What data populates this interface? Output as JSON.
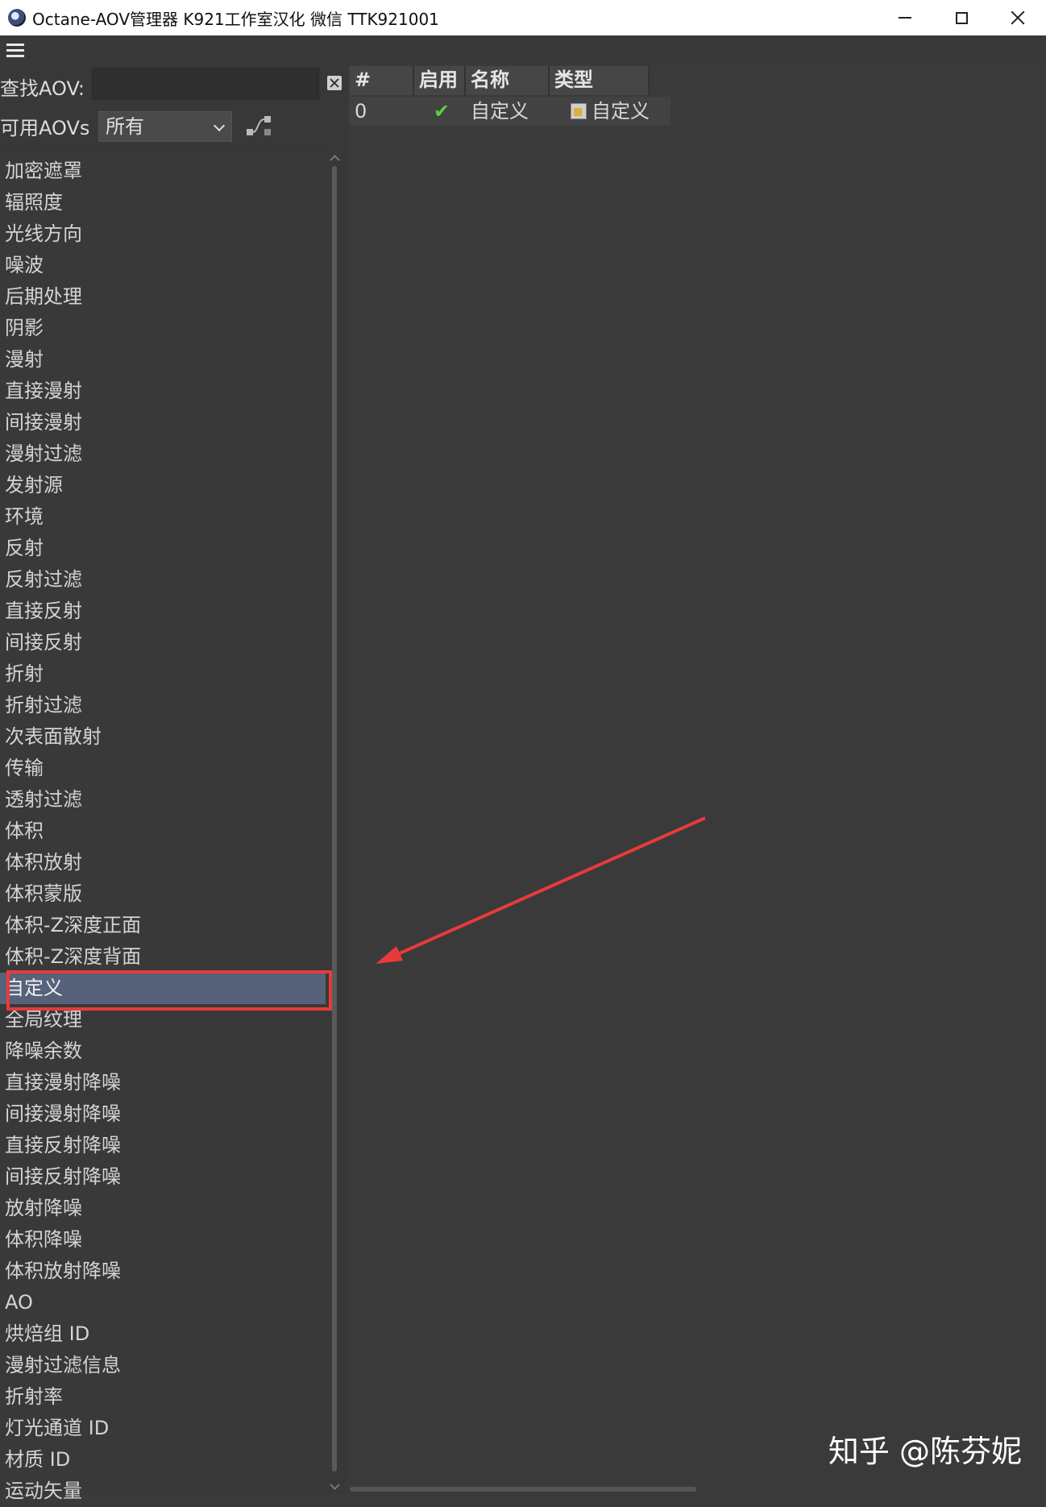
{
  "window": {
    "title": "Octane-AOV管理器  K921工作室汉化  微信  TTK921001"
  },
  "search": {
    "label": "查找AOV:",
    "value": ""
  },
  "filter": {
    "label": "可用AOVs",
    "selected": "所有"
  },
  "aov_list": [
    "加密遮罩",
    "辐照度",
    "光线方向",
    "噪波",
    "后期处理",
    "阴影",
    "漫射",
    "直接漫射",
    "间接漫射",
    "漫射过滤",
    "发射源",
    "环境",
    "反射",
    "反射过滤",
    "直接反射",
    "间接反射",
    "折射",
    "折射过滤",
    "次表面散射",
    "传输",
    "透射过滤",
    "体积",
    "体积放射",
    "体积蒙版",
    "体积-Z深度正面",
    "体积-Z深度背面",
    "自定义",
    "全局纹理",
    "降噪余数",
    "直接漫射降噪",
    "间接漫射降噪",
    "直接反射降噪",
    "间接反射降噪",
    "放射降噪",
    "体积降噪",
    "体积放射降噪",
    "AO",
    "烘焙组 ID",
    "漫射过滤信息",
    "折射率",
    "灯光通道 ID",
    "材质 ID",
    "运动矢量"
  ],
  "selected_index": 26,
  "table": {
    "headers": [
      "#",
      "启用",
      "名称",
      "类型"
    ],
    "rows": [
      {
        "index": "0",
        "enabled_icon": "check-icon",
        "name": "自定义",
        "type": "自定义"
      }
    ]
  },
  "watermark": "知乎 @陈芬妮",
  "colors": {
    "annotation": "#e83a3a",
    "selection": "#56627a",
    "check": "#5bd33c"
  }
}
